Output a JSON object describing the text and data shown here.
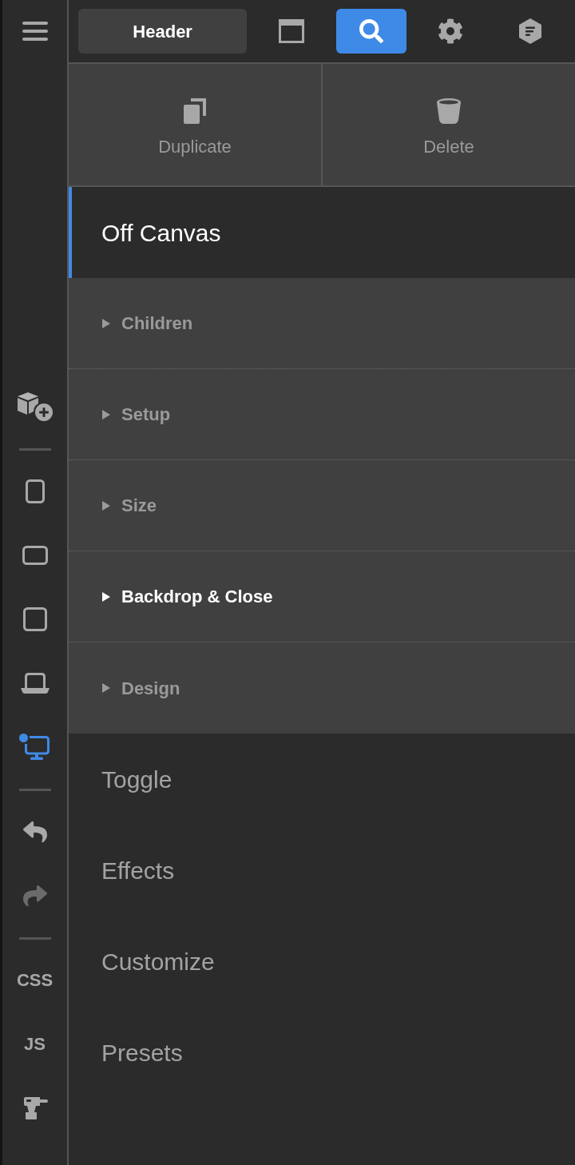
{
  "rail": {
    "devices": [
      {
        "kind": "portrait",
        "selected": false
      },
      {
        "kind": "landscape",
        "selected": false
      },
      {
        "kind": "tablet",
        "selected": false
      },
      {
        "kind": "laptop",
        "selected": false
      },
      {
        "kind": "desktop",
        "selected": true
      }
    ],
    "history": [
      {
        "kind": "undo",
        "disabled": false
      },
      {
        "kind": "redo",
        "disabled": true
      }
    ],
    "code_buttons": [
      "CSS",
      "JS"
    ]
  },
  "toolbar": {
    "element": "Header",
    "tools": [
      {
        "kind": "window",
        "selected": false
      },
      {
        "kind": "search",
        "selected": true
      },
      {
        "kind": "settings",
        "selected": false
      },
      {
        "kind": "notes",
        "selected": false
      }
    ]
  },
  "actions": [
    {
      "kind": "duplicate",
      "label": "Duplicate"
    },
    {
      "kind": "delete",
      "label": "Delete"
    }
  ],
  "sections": [
    {
      "title": "Off Canvas",
      "expanded": true,
      "groups": [
        {
          "label": "Children",
          "highlighted": false
        },
        {
          "label": "Setup",
          "highlighted": false
        },
        {
          "label": "Size",
          "highlighted": false
        },
        {
          "label": "Backdrop & Close",
          "highlighted": true
        },
        {
          "label": "Design",
          "highlighted": false
        }
      ]
    },
    {
      "title": "Toggle",
      "expanded": false
    },
    {
      "title": "Effects",
      "expanded": false
    },
    {
      "title": "Customize",
      "expanded": false
    },
    {
      "title": "Presets",
      "expanded": false
    }
  ]
}
